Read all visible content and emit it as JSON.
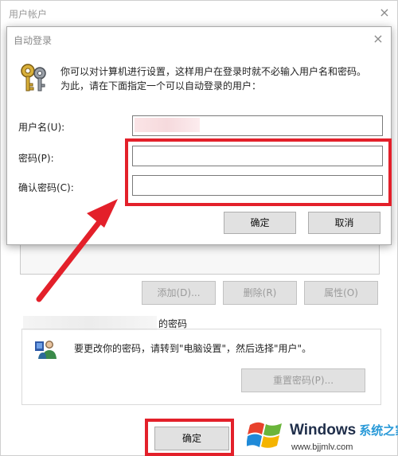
{
  "background_window": {
    "title": "用户帐户",
    "close_glyph": "×",
    "buttons": {
      "add": "添加(D)...",
      "remove": "删除(R)",
      "properties": "属性(O)"
    },
    "password_group": {
      "title": "的密码",
      "hint": "要更改你的密码，请转到\"电脑设置\"，然后选择\"用户\"。",
      "reset_button": "重置密码(P)..."
    },
    "ok_button": "确定"
  },
  "dialog": {
    "title": "自动登录",
    "close_glyph": "×",
    "description_line1": "你可以对计算机进行设置，这样用户在登录时就不必输入用户名和密码。",
    "description_line2": "为此，请在下面指定一个可以自动登录的用户：",
    "fields": {
      "username_label": "用户名(U):",
      "username_value": "",
      "password_label": "密码(P):",
      "password_value": "",
      "confirm_label": "确认密码(C):",
      "confirm_value": ""
    },
    "ok_button": "确定",
    "cancel_button": "取消"
  },
  "annotations": {
    "highlight_color": "#e3202a"
  },
  "watermark": {
    "brand": "Windows",
    "brand_cn": "系统之家",
    "url": "www.bjjmlv.com"
  },
  "icons": {
    "dialog_icon": "keys-icon",
    "group_icon": "users-icon",
    "watermark_logo": "windows-logo-icon"
  }
}
